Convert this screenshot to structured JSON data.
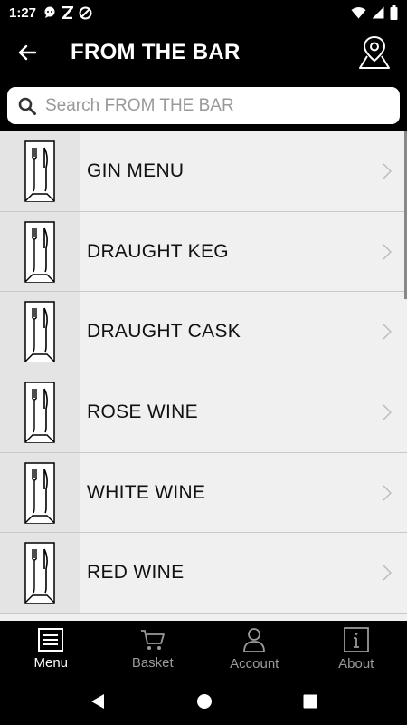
{
  "status": {
    "time": "1:27"
  },
  "header": {
    "title": "FROM THE BAR",
    "back_icon": "arrow-left-icon",
    "location_icon": "map-pin-icon"
  },
  "search": {
    "placeholder": "Search FROM THE BAR"
  },
  "items": [
    {
      "label": "GIN MENU"
    },
    {
      "label": "DRAUGHT KEG"
    },
    {
      "label": "DRAUGHT CASK"
    },
    {
      "label": "ROSE WINE"
    },
    {
      "label": "WHITE WINE"
    },
    {
      "label": "RED WINE"
    }
  ],
  "nav": [
    {
      "label": "Menu",
      "icon": "menu-list-icon",
      "active": true
    },
    {
      "label": "Basket",
      "icon": "cart-icon",
      "active": false
    },
    {
      "label": "Account",
      "icon": "person-icon",
      "active": false
    },
    {
      "label": "About",
      "icon": "info-icon",
      "active": false
    }
  ],
  "colors": {
    "background": "#000000",
    "list_background": "#f0f0f0",
    "active_nav": "#ffffff",
    "inactive_nav": "#9a9a9a"
  }
}
